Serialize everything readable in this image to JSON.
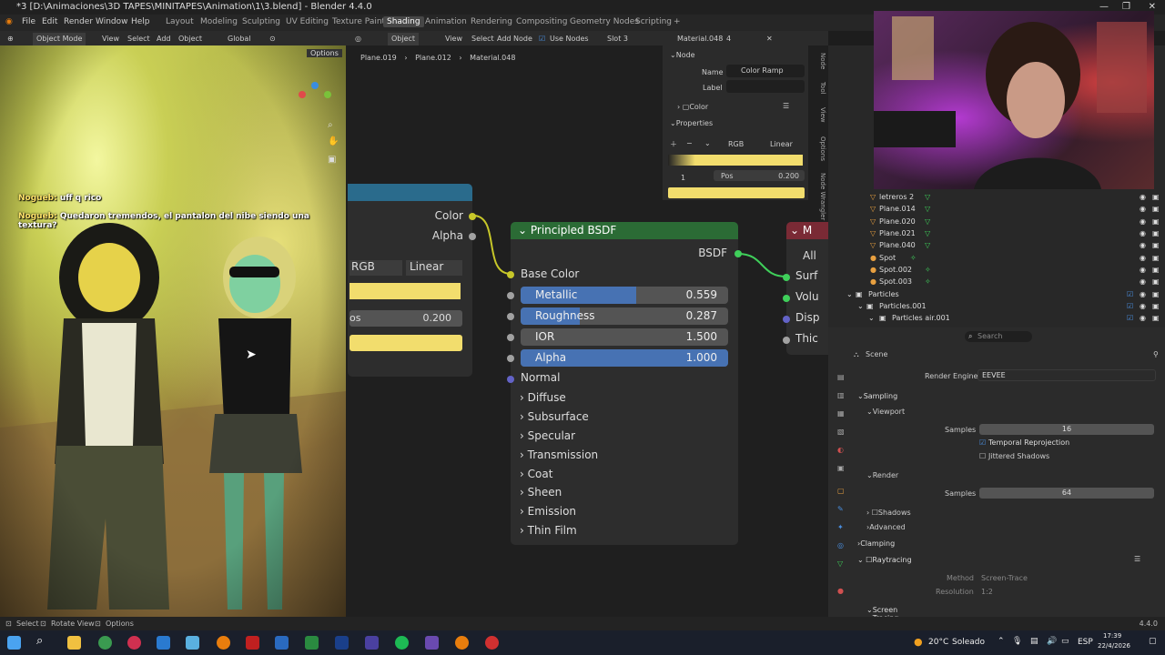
{
  "window": {
    "title": "*3 [D:\\Animaciones\\3D TAPES\\MINITAPES\\Animation\\1\\3.blend] - Blender 4.4.0"
  },
  "menu": [
    "File",
    "Edit",
    "Render",
    "Window",
    "Help"
  ],
  "workspaces": [
    "Layout",
    "Modeling",
    "Sculpting",
    "UV Editing",
    "Texture Paint",
    "Shading",
    "Animation",
    "Rendering",
    "Compositing",
    "Geometry Nodes",
    "Scripting"
  ],
  "active_workspace": "Shading",
  "viewport": {
    "header": {
      "mode": "Object Mode",
      "view": "View",
      "select": "Select",
      "add": "Add",
      "object": "Object",
      "orientation": "Global",
      "options": "Options"
    },
    "chat": [
      {
        "user": "Nogueb:",
        "text": " uff q rico"
      },
      {
        "user": "Nogueb:",
        "text": " Quedaron tremendos, el pantalon del nibe siendo una textura?"
      }
    ]
  },
  "node_editor": {
    "header": {
      "type": "Object",
      "view": "View",
      "select": "Select",
      "add": "Add",
      "node": "Node",
      "use_nodes": "Use Nodes",
      "slot": "Slot 3",
      "material": "Material.048",
      "users": "4"
    },
    "breadcrumb": [
      "Plane.019",
      "Plane.012",
      "Material.048"
    ],
    "color_ramp": {
      "out_color": "Color",
      "out_alpha": "Alpha",
      "mode": "RGB",
      "interp": "Linear",
      "pos_label": "os",
      "pos_value": "0.200"
    },
    "bsdf": {
      "title": "Principled BSDF",
      "output": "BSDF",
      "base_color": "Base Color",
      "sliders": [
        {
          "label": "Metallic",
          "value": "0.559",
          "fill": 0.559
        },
        {
          "label": "Roughness",
          "value": "0.287",
          "fill": 0.287
        },
        {
          "label": "IOR",
          "value": "1.500",
          "fill": 0
        },
        {
          "label": "Alpha",
          "value": "1.000",
          "fill": 1
        }
      ],
      "normal": "Normal",
      "sections": [
        "Diffuse",
        "Subsurface",
        "Specular",
        "Transmission",
        "Coat",
        "Sheen",
        "Emission",
        "Thin Film"
      ]
    },
    "output_node": {
      "title": "M",
      "rows": [
        "All",
        "Surf",
        "Volu",
        "Disp",
        "Thic"
      ]
    }
  },
  "sidebar": {
    "node_label": "Node",
    "name_label": "Name",
    "name_value": "Color Ramp",
    "label_label": "Label",
    "color_label": "Color",
    "properties_label": "Properties",
    "mode": "RGB",
    "interp": "Linear",
    "index": "1",
    "pos_label": "Pos",
    "pos_value": "0.200",
    "tabs": [
      "Node",
      "Tool",
      "View",
      "Options",
      "Node Wrangler"
    ]
  },
  "outliner": {
    "rows": [
      "letreros 2",
      "Plane.014",
      "Plane.020",
      "Plane.021",
      "Plane.040",
      "Spot",
      "Spot.002",
      "Spot.003",
      "Particles",
      "Particles.001",
      "Particles air.001"
    ],
    "search_placeholder": "Search"
  },
  "properties": {
    "scene": "Scene",
    "render_engine_label": "Render Engine",
    "render_engine": "EEVEE",
    "sampling": "Sampling",
    "viewport": "Viewport",
    "samples_label": "Samples",
    "viewport_samples": "16",
    "temporal": "Temporal Reprojection",
    "jittered": "Jittered Shadows",
    "render": "Render",
    "render_samples": "64",
    "shadows": "Shadows",
    "advanced": "Advanced",
    "clamping": "Clamping",
    "raytracing": "Raytracing",
    "method_label": "Method",
    "method": "Screen-Trace",
    "resolution_label": "Resolution",
    "resolution": "1:2",
    "screen_tracing": "Screen Tracing"
  },
  "statusbar": {
    "select": "Select",
    "rotate": "Rotate View",
    "options": "Options",
    "version": "4.4.0"
  },
  "taskbar": {
    "weather_temp": "20°C",
    "weather_text": "Soleado",
    "lang": "ESP",
    "time": "17:39",
    "date": "22/4/2026"
  }
}
